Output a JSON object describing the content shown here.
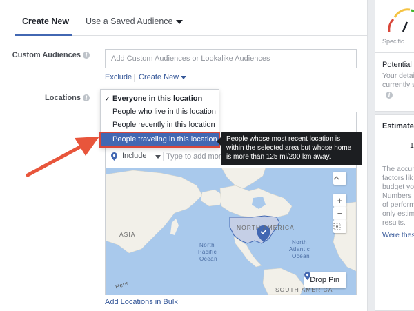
{
  "tabs": [
    {
      "label": "Create New",
      "active": true
    },
    {
      "label": "Use a Saved Audience",
      "active": false
    }
  ],
  "custom_audiences": {
    "label": "Custom Audiences",
    "placeholder": "Add Custom Audiences or Lookalike Audiences",
    "exclude_label": "Exclude",
    "create_new_label": "Create New"
  },
  "locations": {
    "label": "Locations",
    "dropdown_options": [
      {
        "label": "Everyone in this location",
        "checked": true,
        "highlighted": false
      },
      {
        "label": "People who live in this location",
        "checked": false,
        "highlighted": false
      },
      {
        "label": "People recently in this location",
        "checked": false,
        "highlighted": false
      },
      {
        "label": "People traveling in this location",
        "checked": false,
        "highlighted": true
      }
    ],
    "tooltip": "People whose most recent location is within the selected area but whose home is more than 125 mi/200 km away.",
    "include_label": "Include",
    "add_placeholder": "Type to add more",
    "add_bulk_label": "Add Locations in Bulk"
  },
  "map": {
    "labels": {
      "asia": "ASIA",
      "north_america": "NORTH AMERICA",
      "north_pacific": [
        "North",
        "Pacific",
        "Ocean"
      ],
      "north_atlantic": [
        "North",
        "Atlantic",
        "Ocean"
      ],
      "south_america": "SOUTH AMERICA",
      "watermark": "Here"
    },
    "zoom_in": "+",
    "zoom_out": "−",
    "drop_pin_label": "Drop Pin"
  },
  "right_panel": {
    "gauge_label": "Specific",
    "potential_reach_title": "Potential R",
    "potential_reach_lines": [
      "Your detai",
      "currently s"
    ],
    "estimated_title": "Estimate",
    "estimated_value": "1,",
    "estimated_lines": [
      "The accur",
      "factors lik",
      "budget yo",
      "Numbers a",
      "of perform",
      "only estim",
      "results."
    ],
    "link": "Were thes"
  },
  "colors": {
    "accent": "#4267b2",
    "link": "#365899",
    "highlight_outline": "#d9473a",
    "arrow": "#e8553b",
    "map_water": "#a9c9ec",
    "map_land": "#f2f0e9"
  }
}
